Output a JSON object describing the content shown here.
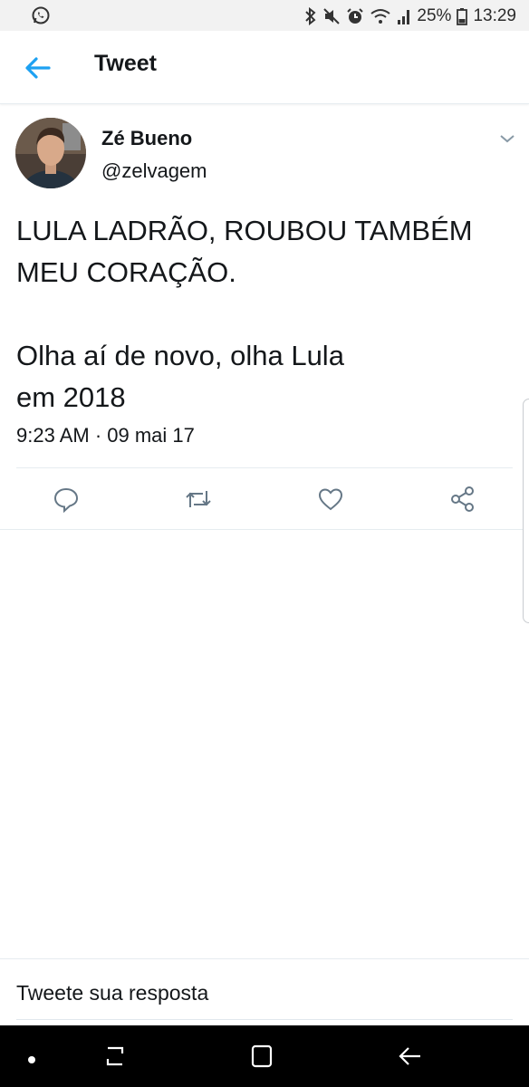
{
  "status_bar": {
    "battery": "25%",
    "time": "13:29",
    "icons": [
      "whatsapp-icon",
      "bluetooth-icon",
      "mute-icon",
      "alarm-icon",
      "wifi-icon",
      "signal-icon",
      "battery-icon"
    ]
  },
  "header": {
    "title": "Tweet",
    "back_icon": "arrow-left-icon"
  },
  "tweet": {
    "author_name": "Zé Bueno",
    "author_handle": "@zelvagem",
    "text": "LULA LADRÃO, ROUBOU TAMBÉM MEU CORAÇÃO.\n\nOlha aí  de novo, olha Lula\nem 2018",
    "timestamp": "9:23 AM · 09 mai 17",
    "actions": [
      "reply-icon",
      "retweet-icon",
      "like-icon",
      "share-icon"
    ]
  },
  "reply": {
    "placeholder": "Tweete sua resposta"
  },
  "colors": {
    "accent": "#1da1f2",
    "text": "#14171a",
    "icon_gray": "#657786",
    "divider": "#e6ecf0"
  }
}
